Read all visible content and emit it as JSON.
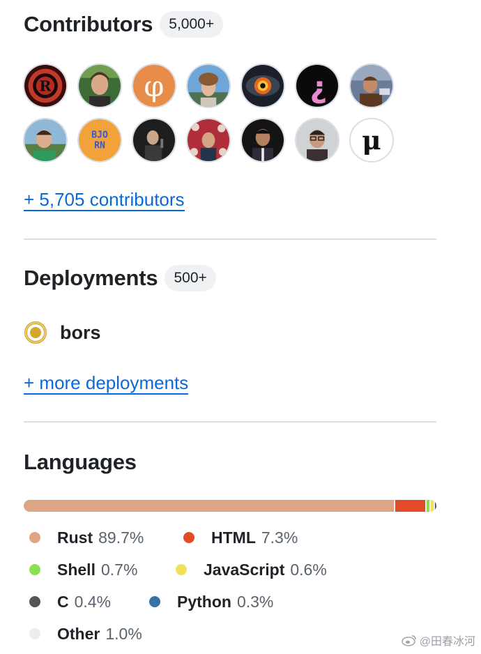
{
  "contributors": {
    "title": "Contributors",
    "count": "5,000+",
    "more_link": "+ 5,705 contributors",
    "avatars_row1": [
      "avatar-1",
      "avatar-2",
      "avatar-3",
      "avatar-4",
      "avatar-5",
      "avatar-6",
      "avatar-7"
    ],
    "avatars_row2": [
      "avatar-8",
      "avatar-9",
      "avatar-10",
      "avatar-11",
      "avatar-12",
      "avatar-13",
      "avatar-14"
    ]
  },
  "deployments": {
    "title": "Deployments",
    "count": "500+",
    "item_name": "bors",
    "item_icon": "deployment-status-icon",
    "more_link": "+ more deployments"
  },
  "languages": {
    "title": "Languages",
    "items": [
      {
        "name": "Rust",
        "percent": "89.7%",
        "value": 89.7,
        "color": "#dea584"
      },
      {
        "name": "HTML",
        "percent": "7.3%",
        "value": 7.3,
        "color": "#e34c26"
      },
      {
        "name": "Shell",
        "percent": "0.7%",
        "value": 0.7,
        "color": "#89e051"
      },
      {
        "name": "JavaScript",
        "percent": "0.6%",
        "value": 0.6,
        "color": "#f1e05a"
      },
      {
        "name": "C",
        "percent": "0.4%",
        "value": 0.4,
        "color": "#555555"
      },
      {
        "name": "Python",
        "percent": "0.3%",
        "value": 0.3,
        "color": "#3572A5"
      },
      {
        "name": "Other",
        "percent": "1.0%",
        "value": 1.0,
        "color": "#ededed"
      }
    ]
  },
  "watermark": {
    "text": "@田春冰河",
    "icon": "weibo-icon"
  }
}
